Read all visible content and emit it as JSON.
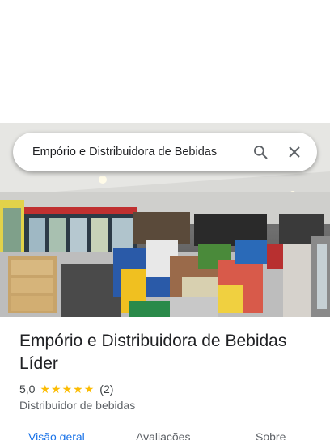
{
  "search": {
    "query": "Empório e Distribuidora de Bebidas"
  },
  "place": {
    "name": "Empório e Distribuidora de Bebidas Líder",
    "rating": "5,0",
    "stars": [
      "★",
      "★",
      "★",
      "★",
      "★"
    ],
    "review_count": "(2)",
    "category": "Distribuidor de bebidas"
  },
  "tabs": [
    {
      "label": "Visão geral",
      "active": true
    },
    {
      "label": "Avaliações",
      "active": false
    },
    {
      "label": "Sobre",
      "active": false
    }
  ],
  "icons": {
    "search": "search-icon",
    "close": "close-icon"
  },
  "colors": {
    "accent": "#1a73e8",
    "star": "#fbbc04"
  }
}
